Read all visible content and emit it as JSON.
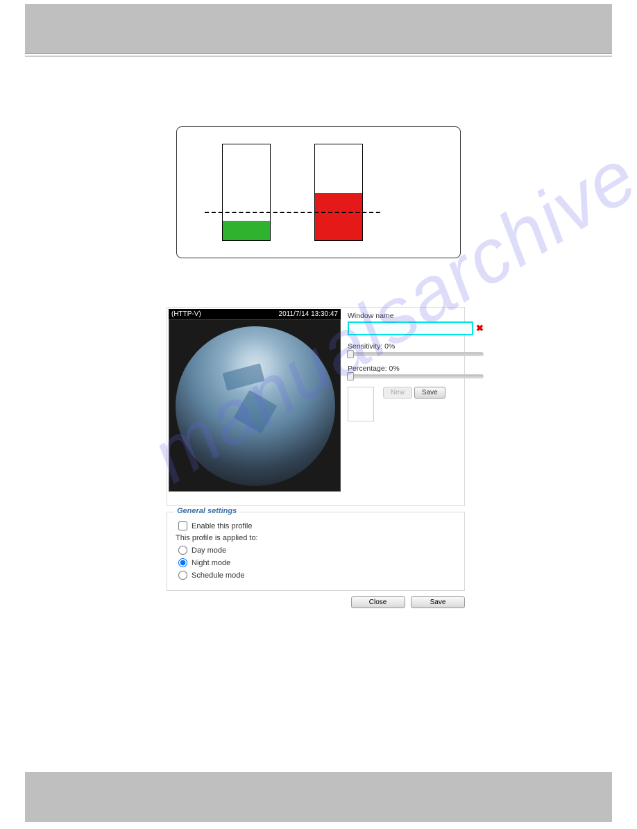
{
  "video": {
    "protocol": "(HTTP-V)",
    "timestamp": "2011/7/14 13:30:47"
  },
  "config": {
    "window_name_label": "Window name",
    "window_name_value": "",
    "sensitivity_label": "Sensitivity: 0%",
    "sensitivity_value": 0,
    "percentage_label": "Percentage: 0%",
    "percentage_value": 0,
    "new_button": "New",
    "save_button": "Save"
  },
  "general": {
    "legend": "General settings",
    "enable_label": "Enable this profile",
    "enable_checked": false,
    "applied_text": "This profile is applied to:",
    "options": [
      {
        "label": "Day mode",
        "checked": false
      },
      {
        "label": "Night mode",
        "checked": true
      },
      {
        "label": "Schedule mode",
        "checked": false
      }
    ]
  },
  "footer": {
    "close": "Close",
    "save": "Save"
  },
  "watermark": "manualsarchive.com",
  "chart_data": {
    "type": "bar",
    "description": "Motion detection percentage indicator bars with threshold line",
    "bars": [
      {
        "color": "green",
        "fill_percent_approx": 20,
        "state": "below_threshold"
      },
      {
        "color": "red",
        "fill_percent_approx": 49,
        "state": "above_threshold"
      }
    ],
    "threshold_line_percent_approx": 40
  }
}
